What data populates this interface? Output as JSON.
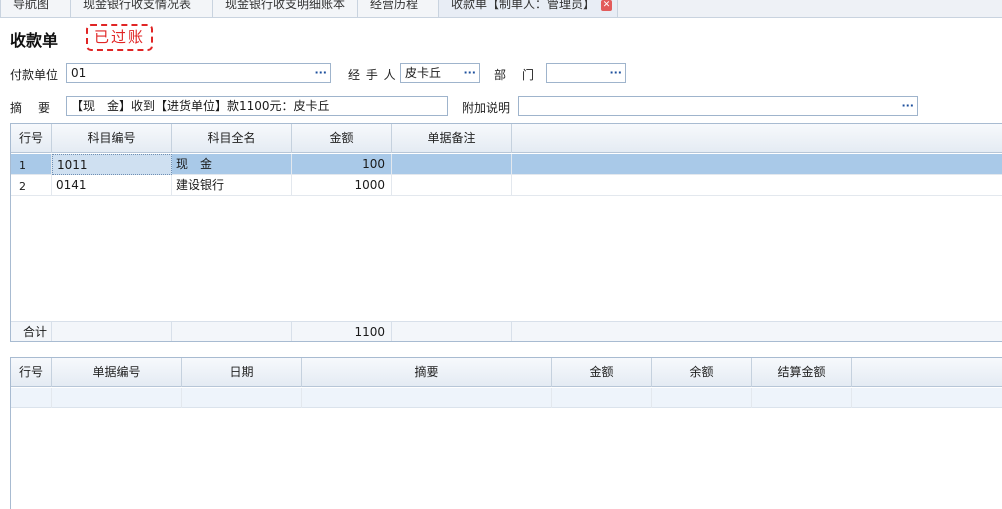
{
  "tabs": [
    {
      "label": "导航图"
    },
    {
      "label": "现金银行收支情况表"
    },
    {
      "label": "现金银行收支明细账本"
    },
    {
      "label": "经营历程"
    },
    {
      "label": "收款单【制单人：管理员】"
    }
  ],
  "form": {
    "title": "收款单",
    "stamp": "已过账",
    "payer_label": "付款单位",
    "payer_value": "01",
    "handler_label": "经 手 人",
    "handler_value": "皮卡丘",
    "dept_label": "部　门",
    "dept_value": "",
    "summary_label": "摘　要",
    "summary_value": "【现　金】收到【进货单位】款1100元：皮卡丘",
    "note_label": "附加说明",
    "note_value": "",
    "dots": "···"
  },
  "grid1": {
    "headers": [
      "行号",
      "科目编号",
      "科目全名",
      "金额",
      "单据备注"
    ],
    "rows": [
      {
        "no": "1",
        "code": "1011",
        "name": "现　金",
        "amount": "100",
        "remark": ""
      },
      {
        "no": "2",
        "code": "0141",
        "name": "建设银行",
        "amount": "1000",
        "remark": ""
      }
    ],
    "total_label": "合计",
    "total_amount": "1100"
  },
  "grid2": {
    "headers": [
      "行号",
      "单据编号",
      "日期",
      "摘要",
      "金额",
      "余额",
      "结算金额"
    ]
  },
  "colors": {
    "accent": "#a9c9e8",
    "stamp": "#e02525",
    "border": "#a8bbd1"
  },
  "icons": {
    "close": "close-icon",
    "ellipsis": "ellipsis-icon"
  }
}
